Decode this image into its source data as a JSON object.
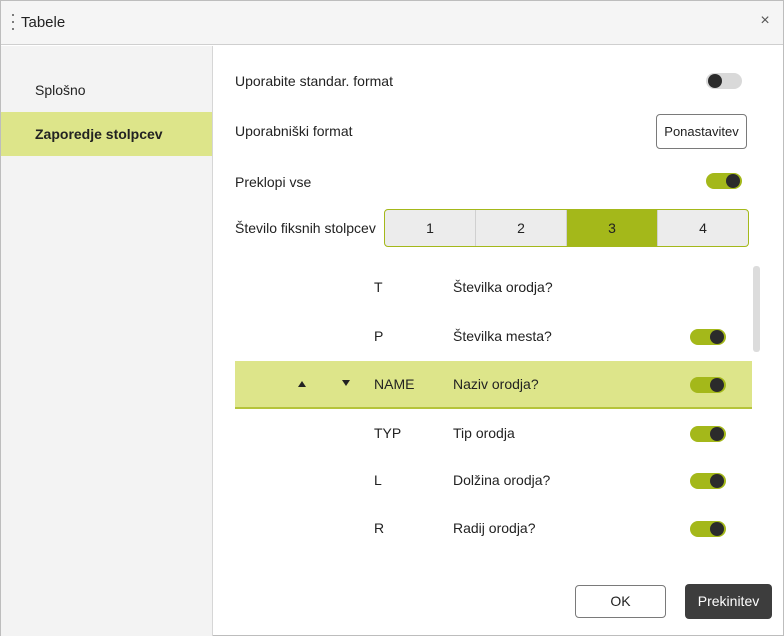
{
  "dialog": {
    "title": "Tabele",
    "close_symbol": "×",
    "title_icon": "kebab-menu-icon",
    "close_icon": "close-icon"
  },
  "sidebar": {
    "items": [
      {
        "label": "Splošno",
        "active": false
      },
      {
        "label": "Zaporedje stolpcev",
        "active": true
      }
    ]
  },
  "settings": {
    "standard_format": {
      "label": "Uporabite standar. format",
      "on": false
    },
    "user_format": {
      "label": "Uporabniški format",
      "button": "Ponastavitev"
    },
    "toggle_all": {
      "label": "Preklopi vse",
      "on": true
    },
    "fixed_columns": {
      "label": "Število fiksnih stolpcev",
      "options": [
        "1",
        "2",
        "3",
        "4"
      ],
      "selected": "3"
    }
  },
  "columns": [
    {
      "code": "T",
      "desc": "Številka orodja?",
      "has_toggle": false,
      "on": null,
      "selected": false
    },
    {
      "code": "P",
      "desc": "Številka mesta?",
      "has_toggle": true,
      "on": true,
      "selected": false
    },
    {
      "code": "NAME",
      "desc": "Naziv orodja?",
      "has_toggle": true,
      "on": true,
      "selected": true
    },
    {
      "code": "TYP",
      "desc": "Tip orodja",
      "has_toggle": true,
      "on": true,
      "selected": false
    },
    {
      "code": "L",
      "desc": "Dolžina orodja?",
      "has_toggle": true,
      "on": true,
      "selected": false
    },
    {
      "code": "R",
      "desc": "Radij orodja?",
      "has_toggle": true,
      "on": true,
      "selected": false
    }
  ],
  "footer": {
    "ok_label": "OK",
    "cancel_label": "Prekinitev"
  },
  "colors": {
    "accent": "#a4b81a",
    "selected_row": "#dde58a",
    "sidebar_bg": "#f3f3f3",
    "cancel_bg": "#3d3d3d"
  }
}
